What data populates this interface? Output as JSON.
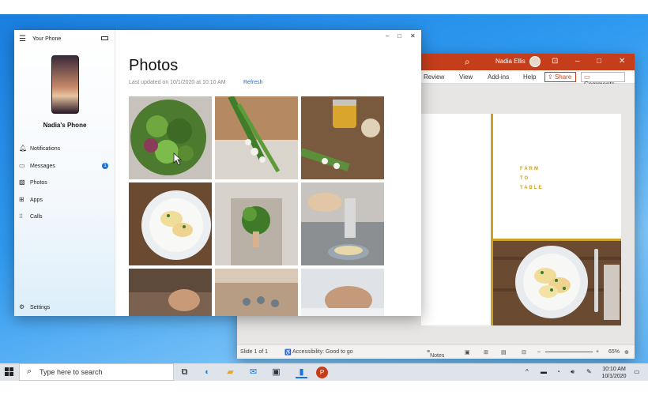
{
  "your_phone": {
    "app_title": "Your Phone",
    "phone_name": "Nadia's Phone",
    "nav": [
      {
        "label": "Notifications",
        "icon": "bell-icon"
      },
      {
        "label": "Messages",
        "icon": "message-icon",
        "badge": "1"
      },
      {
        "label": "Photos",
        "icon": "photo-icon",
        "active": true
      },
      {
        "label": "Apps",
        "icon": "apps-icon"
      },
      {
        "label": "Calls",
        "icon": "calls-icon"
      }
    ],
    "settings_label": "Settings",
    "photos": {
      "title": "Photos",
      "updated": "Last updated on 10/1/2020 at 10:10 AM",
      "refresh": "Refresh"
    }
  },
  "powerpoint": {
    "user_name": "Nadia Ellis",
    "ribbon_tabs": [
      "Review",
      "View",
      "Add-ins",
      "Help"
    ],
    "share_label": "Share",
    "comments_label": "Comments",
    "slide_text": [
      "FARM",
      "TO",
      "TABLE"
    ],
    "status": {
      "slide_count": "Slide 1 of 1",
      "accessibility": "Accessibility: Good to go",
      "notes": "Notes",
      "zoom": "65%"
    }
  },
  "taskbar": {
    "search_placeholder": "Type here to search",
    "time": "10:10 AM",
    "date": "10/1/2020"
  },
  "colors": {
    "ppt_accent": "#c43e1c",
    "link_blue": "#1a73d9",
    "slide_gold": "#c9a227"
  }
}
